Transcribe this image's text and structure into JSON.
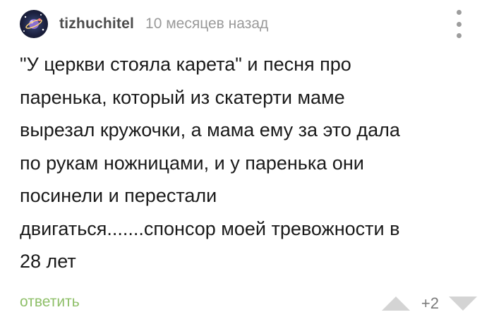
{
  "comment": {
    "author": "tizhuchitel",
    "time": "10 месяцев назад",
    "text": "\"У церкви стояла карета\" и песня про\nпаренька, который из скатерти маме\nвырезал кружочки, а мама ему за это дала\nпо рукам ножницами, и у паренька они\nпосинели и перестали\nдвигаться.......спонсор моей тревожности в\n28 лет",
    "reply_label": "ответить",
    "rating": "+2"
  },
  "icons": {
    "avatar": "space-avatar",
    "menu": "more-vertical-icon",
    "upvote": "arrow-up-triangle-icon",
    "downvote": "arrow-down-triangle-icon"
  },
  "colors": {
    "author": "#4d4d4d",
    "time": "#9a9a9a",
    "reply": "#8ebf68",
    "vote_arrow": "#d4d4d4",
    "rating": "#7a7a7a"
  }
}
